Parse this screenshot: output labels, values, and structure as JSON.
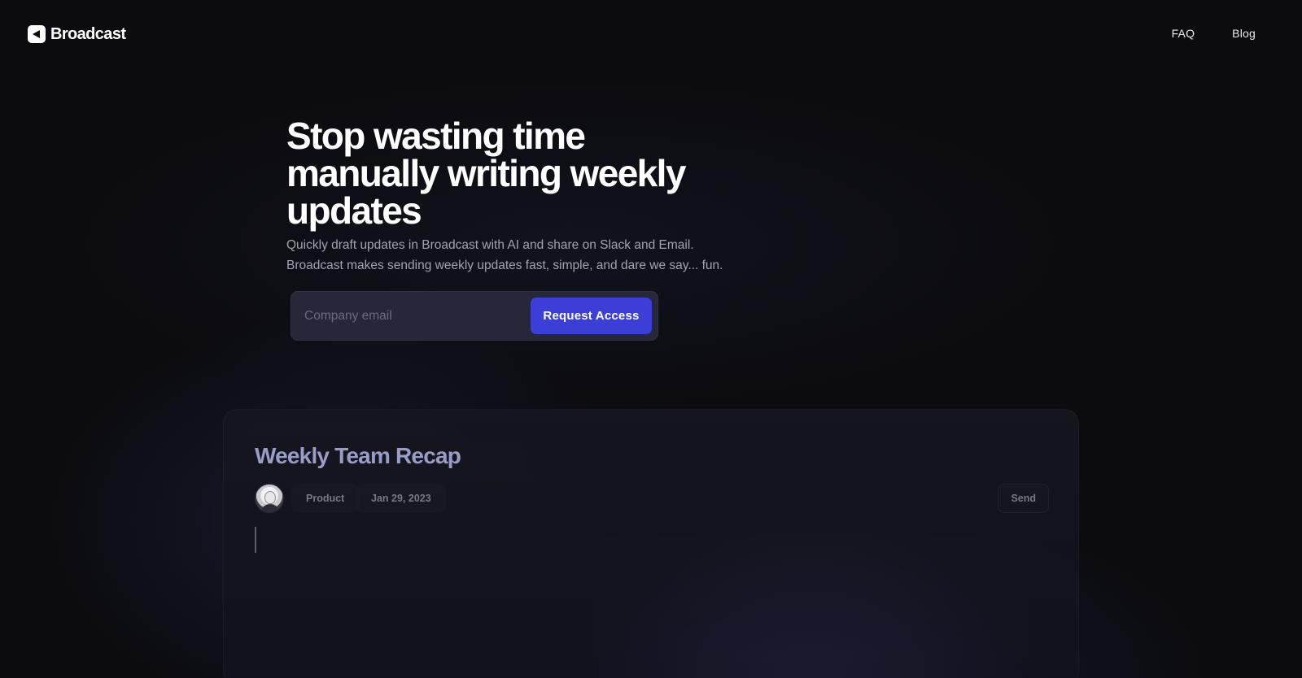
{
  "header": {
    "brand": "Broadcast",
    "nav": [
      {
        "label": "FAQ"
      },
      {
        "label": "Blog"
      }
    ]
  },
  "hero": {
    "title": "Stop wasting time manually writing weekly updates",
    "subtitle_line1": "Quickly draft updates in Broadcast with AI and share on Slack and Email.",
    "subtitle_line2": "Broadcast makes sending weekly updates fast, simple, and dare we say... fun.",
    "email_placeholder": "Company email",
    "email_value": "",
    "cta_label": "Request Access"
  },
  "preview": {
    "title": "Weekly Team Recap",
    "tag": "Product",
    "date": "Jan 29, 2023",
    "send_label": "Send"
  },
  "colors": {
    "background": "#0b0b10",
    "accent": "#3c3ed8",
    "doc_title": "#9a9cc8",
    "muted_text": "#a3a3b0"
  },
  "icons": {
    "logo": "broadcast-logo-icon",
    "avatar": "user-avatar"
  }
}
